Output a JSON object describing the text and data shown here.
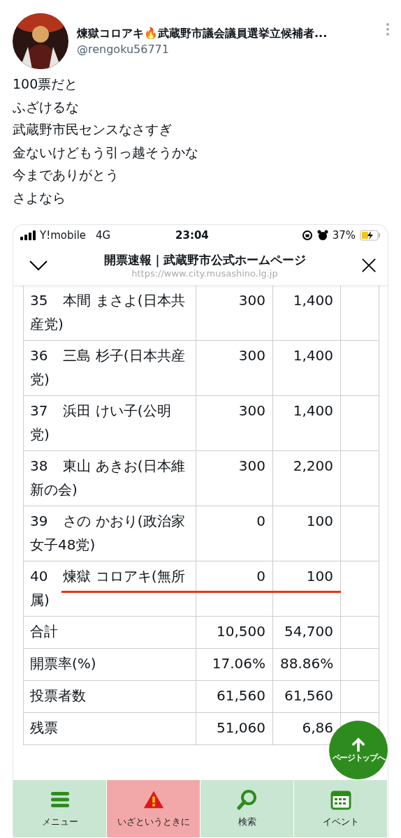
{
  "tweet": {
    "display_name": "煉獄コロアキ🔥武蔵野市議会議員選挙立候補者...",
    "handle": "@rengoku56771",
    "lines": [
      "100票だと",
      "ふざけるな",
      "武蔵野市民センスなさすぎ",
      "金ないけどもう引っ越そうかな",
      "今までありがとう",
      "さよなら"
    ]
  },
  "phone": {
    "status_bar": {
      "carrier": "Y!mobile",
      "network": "4G",
      "time": "23:04",
      "battery": "37%"
    },
    "browser": {
      "title": "開票速報｜武蔵野市公式ホームページ",
      "url": "https://www.city.musashino.lg.jp"
    },
    "table": {
      "rows": [
        {
          "kind": "candidate",
          "number": "35",
          "name": "本間 まさよ(日本共産党)",
          "column_2": "300",
          "column_3": "1,400",
          "highlighted": false
        },
        {
          "kind": "candidate",
          "number": "36",
          "name": "三島 杉子(日本共産党)",
          "column_2": "300",
          "column_3": "1,400",
          "highlighted": false
        },
        {
          "kind": "candidate",
          "number": "37",
          "name": "浜田 けい子(公明党)",
          "column_2": "300",
          "column_3": "1,400",
          "highlighted": false
        },
        {
          "kind": "candidate",
          "number": "38",
          "name": "東山 あきお(日本維新の会)",
          "column_2": "300",
          "column_3": "2,200",
          "highlighted": false
        },
        {
          "kind": "candidate",
          "number": "39",
          "name": "さの かおり(政治家女子48党)",
          "column_2": "0",
          "column_3": "100",
          "highlighted": false
        },
        {
          "kind": "candidate",
          "number": "40",
          "name": "煉獄 コロアキ(無所属)",
          "column_2": "0",
          "column_3": "100",
          "highlighted": true
        },
        {
          "kind": "summary",
          "name": "合計",
          "column_2": "10,500",
          "column_3": "54,700"
        },
        {
          "kind": "summary",
          "name": "開票率(%)",
          "column_2": "17.06%",
          "column_3": "88.86%"
        },
        {
          "kind": "summary",
          "name": "投票者数",
          "column_2": "61,560",
          "column_3": "61,560"
        },
        {
          "kind": "summary",
          "name": "残票",
          "column_2": "51,060",
          "column_3": "6,86"
        }
      ]
    },
    "page_top_button": "ページトップへ",
    "nav": [
      {
        "kind": "menu",
        "label": "メニュー"
      },
      {
        "kind": "alert",
        "label": "いざというときに"
      },
      {
        "kind": "search",
        "label": "検索"
      },
      {
        "kind": "event",
        "label": "イベント"
      }
    ]
  }
}
